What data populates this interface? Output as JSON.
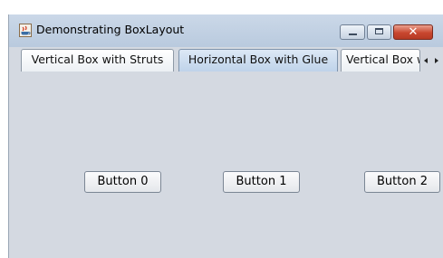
{
  "window": {
    "title": "Demonstrating BoxLayout",
    "app_icon": "java-cup-icon",
    "controls": {
      "minimize_icon": "minimize-icon",
      "maximize_icon": "maximize-icon",
      "close_icon": "close-icon",
      "close_glyph": "✕",
      "close_color": "#c9472f"
    }
  },
  "tabs": [
    {
      "label": "Vertical Box with Struts",
      "selected": false
    },
    {
      "label": "Horizontal Box with Glue",
      "selected": true
    },
    {
      "label": "Vertical Box with Rigid Areas",
      "selected": false
    }
  ],
  "tab_scroll": {
    "left_icon": "tab-scroll-left-icon",
    "right_icon": "tab-scroll-right-icon"
  },
  "panel": {
    "buttons": [
      {
        "label": "Button 0"
      },
      {
        "label": "Button 1"
      },
      {
        "label": "Button 2"
      }
    ]
  }
}
